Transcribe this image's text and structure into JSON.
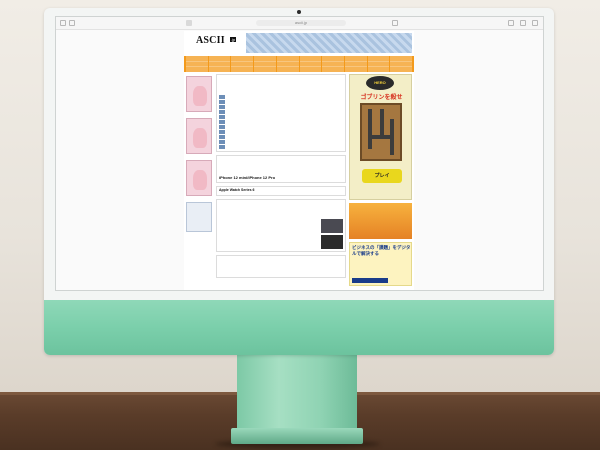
{
  "browser": {
    "url": "ascii.jp"
  },
  "site": {
    "logo": "ASCII",
    "logo_jp": ".jp",
    "nav_row1": [
      "",
      "",
      "",
      "",
      "",
      "",
      "",
      "",
      "",
      "",
      "",
      ""
    ],
    "nav_row2": [
      "",
      "",
      "",
      "",
      "",
      "",
      "",
      "",
      "",
      "",
      "",
      ""
    ],
    "nav_row3": [
      "",
      "",
      "",
      "",
      "",
      "",
      "",
      "",
      "",
      "",
      "",
      ""
    ]
  },
  "main": {
    "feature_headline": "iPhone 12 mini/iPhone 12 Pro",
    "watch_headline": "Apple Watch Series 6"
  },
  "ads": {
    "goblin_badge": "HERO",
    "goblin_title": "ゴブリンを殺せ",
    "goblin_play": "プレイ",
    "ad2_title": "",
    "ad3_title": "ビジネスの「課題」をデジタルで解決する",
    "ad3_cta": ""
  },
  "colors": {
    "chin": "#7bcfab",
    "nav": "#f39a1b"
  }
}
